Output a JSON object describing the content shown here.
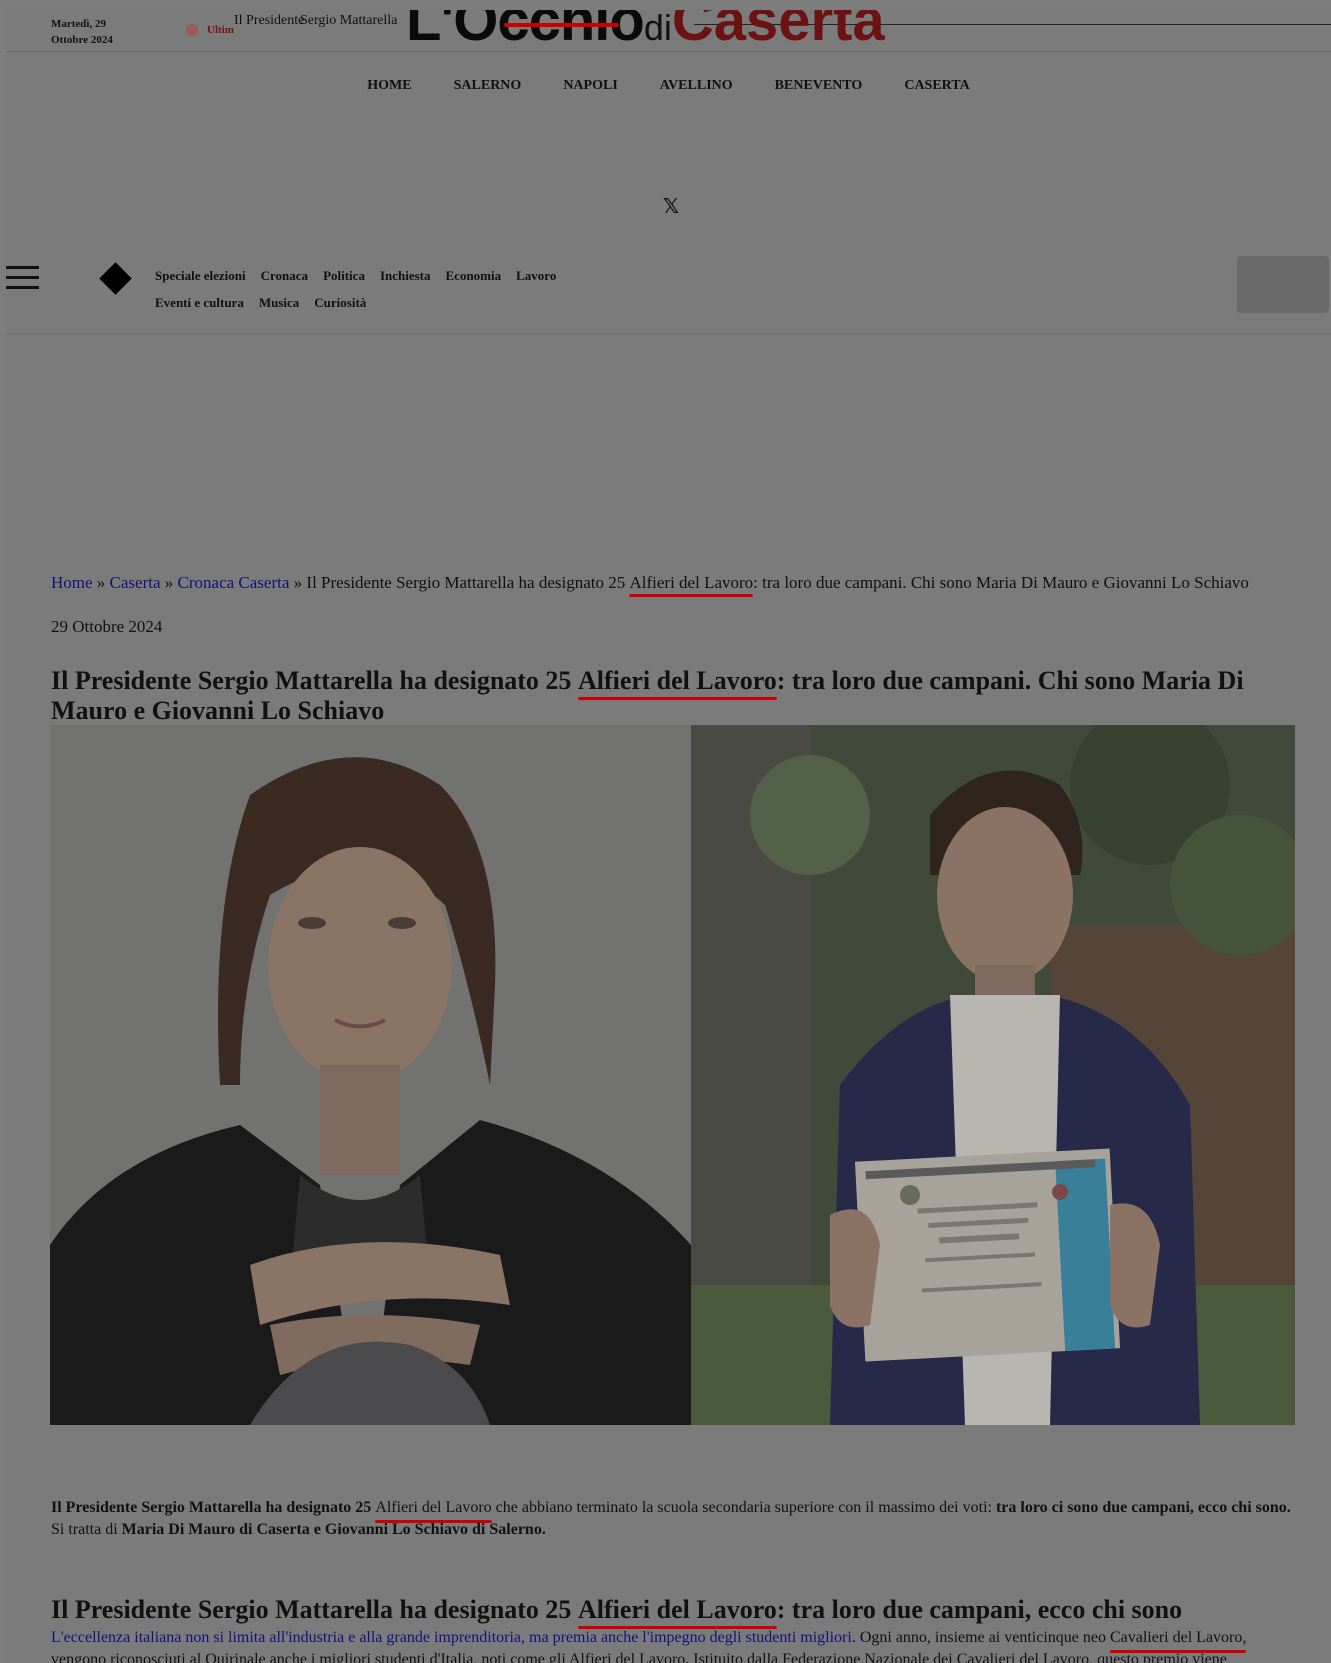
{
  "topbar": {
    "date_line1": "Martedì, 29",
    "date_line2": "Ottobre 2024",
    "ultim_label": "Ultim",
    "ticker_a": "Il Presidente",
    "ticker_b": "Sergio Mattarella"
  },
  "logo": {
    "part1": "L'Occhio",
    "part2": "di",
    "part3": "Caserta"
  },
  "main_nav": [
    "HOME",
    "SALERNO",
    "NAPOLI",
    "AVELLINO",
    "BENEVENTO",
    "CASERTA"
  ],
  "social": {
    "x_icon": "𝕏"
  },
  "categories": [
    "Speciale elezioni",
    "Cronaca",
    "Politica",
    "Inchiesta",
    "Economia",
    "Lavoro",
    "Eventi e cultura",
    "Musica",
    "Curiosità"
  ],
  "breadcrumb": {
    "home": "Home",
    "sep": " » ",
    "caserta": "Caserta",
    "cronaca": "Cronaca Caserta",
    "current_pre": "Il Presidente Sergio Mattarella ha designato 25 ",
    "current_hl": "Alfieri del Lavoro",
    "current_post": ": tra loro due campani. Chi sono Maria Di Mauro e Giovanni Lo Schiavo"
  },
  "article": {
    "date": "29 Ottobre 2024",
    "title_pre": "Il Presidente Sergio Mattarella ha designato 25 ",
    "title_hl": "Alfieri del Lavoro",
    "title_post": ": tra loro due campani. Chi sono Maria Di Mauro e Giovanni Lo Schiavo",
    "lead_b1": "Il Presidente Sergio Mattarella ha designato 25 ",
    "lead_hl": "Alfieri del Lavoro",
    "lead_t1": " che abbiano terminato la scuola secondaria superiore con il massimo dei voti: ",
    "lead_b2": "tra loro ci sono due campani, ecco chi sono.",
    "lead_t2": " Si tratta di ",
    "lead_b3": "Maria Di Mauro di Caserta e Giovanni Lo Schiavo di Salerno.",
    "h2_pre": "Il Presidente Sergio Mattarella ha designato 25 ",
    "h2_hl": "Alfieri del Lavoro",
    "h2_post": ": tra loro due campani, ecco chi sono",
    "p_link": "L'eccellenza italiana non si limita all'industria e alla grande imprenditoria, ma premia anche l'impegno degli studenti migliori",
    "p_t1": ". Ogni anno, insieme ai venticinque neo ",
    "p_hl": "Cavalieri del Lavoro,",
    "p_t2": " vengono riconosciuti al Quirinale anche i migliori studenti d'Italia, noti come gli Alfieri del Lavoro. Istituito dalla Federazione Nazionale dei Cavalieri del Lavoro, questo premio viene"
  }
}
